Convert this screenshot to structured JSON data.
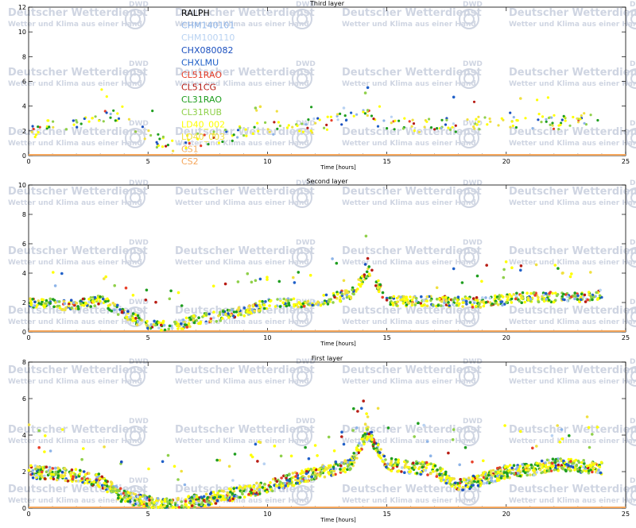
{
  "watermark": {
    "title": "Deutscher Wetterdienst",
    "subtitle": "Wetter und Klima aus einer Hand",
    "logo_text": "DWD"
  },
  "colors": {
    "axis": "#000000",
    "watermark": "#cfd5e2",
    "baseline": "#f5a65b"
  },
  "chart_data": [
    {
      "type": "scatter",
      "title": "Third layer",
      "xlabel": "Time [hours]",
      "ylabel": "",
      "xlim": [
        0,
        25
      ],
      "ylim": [
        0,
        12
      ],
      "xticks": [
        0,
        5,
        10,
        15,
        20,
        25
      ],
      "yticks": [
        0,
        2,
        4,
        6,
        8,
        10,
        12
      ],
      "legend_position": "top-left (inside)",
      "grid": false,
      "series": [
        {
          "name": "RALPH",
          "color": "#000000"
        },
        {
          "name": "CHM140101",
          "color": "#8db4e8"
        },
        {
          "name": "CHM100110",
          "color": "#b8d2f2"
        },
        {
          "name": "CHX080082",
          "color": "#1a4fbf"
        },
        {
          "name": "CHXLMU",
          "color": "#2060c8"
        },
        {
          "name": "CL51RAO",
          "color": "#e8402a"
        },
        {
          "name": "CL51CG",
          "color": "#b81c14"
        },
        {
          "name": "CL31RAO",
          "color": "#1f9e1f"
        },
        {
          "name": "CL31RUB",
          "color": "#8fd04a"
        },
        {
          "name": "LD40_002",
          "color": "#ffff00"
        },
        {
          "name": "LD40_003",
          "color": "#f0e040"
        },
        {
          "name": "CS1",
          "color": "#f5b060"
        },
        {
          "name": "CS2",
          "color": "#f5a65b"
        }
      ]
    },
    {
      "type": "scatter",
      "title": "Second layer",
      "xlabel": "Time [hours]",
      "ylabel": "",
      "xlim": [
        0,
        25
      ],
      "ylim": [
        0,
        10
      ],
      "xticks": [
        0,
        5,
        10,
        15,
        20,
        25
      ],
      "yticks": [
        0,
        2,
        4,
        6,
        8,
        10
      ],
      "grid": false
    },
    {
      "type": "scatter",
      "title": "First layer",
      "xlabel": "Time [hours]",
      "ylabel": "",
      "xlim": [
        0,
        25
      ],
      "ylim": [
        0,
        8
      ],
      "xticks": [
        0,
        5,
        10,
        15,
        20,
        25
      ],
      "yticks": [
        0,
        2,
        4,
        6,
        8
      ],
      "grid": false
    }
  ]
}
